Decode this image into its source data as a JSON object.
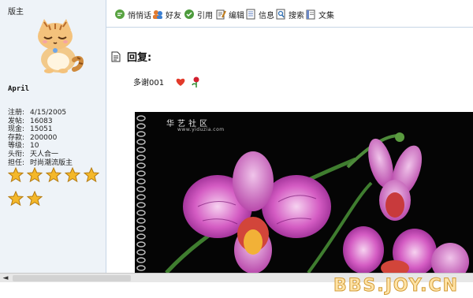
{
  "left_panel": {
    "role": "版主",
    "username": "April",
    "stats": [
      {
        "label": "注册:",
        "value": "4/15/2005"
      },
      {
        "label": "发帖:",
        "value": "16083"
      },
      {
        "label": "现金:",
        "value": "15051"
      },
      {
        "label": "存款:",
        "value": "200000"
      },
      {
        "label": "等级:",
        "value": "10"
      },
      {
        "label": "头衔:",
        "value": "天人合一"
      },
      {
        "label": "担任:",
        "value": "时尚潮流版主"
      }
    ],
    "star_count": 7
  },
  "toolbar": [
    {
      "label": "悄悄话",
      "icon": "chat-bubble-icon"
    },
    {
      "label": "好友",
      "icon": "friends-icon"
    },
    {
      "label": "引用",
      "icon": "quote-icon"
    },
    {
      "label": "编辑",
      "icon": "edit-icon"
    },
    {
      "label": "信息",
      "icon": "info-icon"
    },
    {
      "label": "搜索",
      "icon": "search-icon"
    },
    {
      "label": "文集",
      "icon": "book-icon"
    }
  ],
  "post": {
    "reply_label": "回复:",
    "message": "多谢001"
  },
  "image": {
    "title": "华艺社区",
    "url": "www.yiduzia.com"
  },
  "watermark": "BBS.JOY.CN",
  "scroll": {
    "left_arrow": "◄"
  }
}
